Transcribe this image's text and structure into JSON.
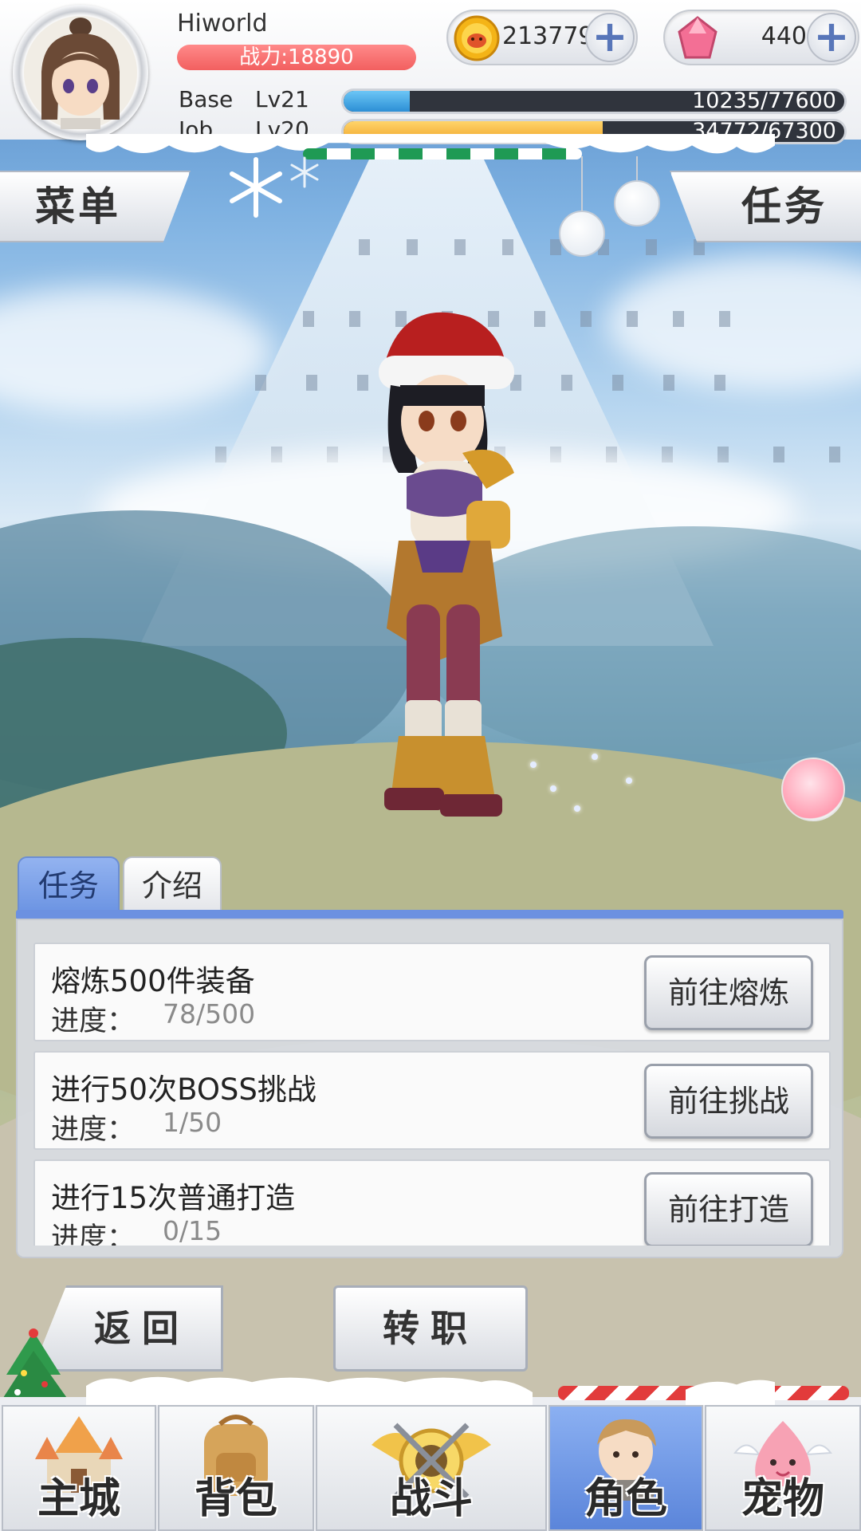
{
  "player": {
    "name": "Hiworld",
    "power": "战力:18890",
    "base_label": "Base",
    "base_level": "Lv21",
    "base_exp": "10235/77600",
    "base_progress": 0.132,
    "job_label": "Job",
    "job_level": "Lv20",
    "job_exp": "34772/67300",
    "job_progress": 0.517
  },
  "currency": {
    "gold": "213779",
    "gems": "440",
    "gold_icon": "coin-icon",
    "gem_icon": "crystal-icon",
    "add_icon": "plus-icon"
  },
  "buttons": {
    "menu": "菜单",
    "quest": "任务",
    "back": "返回",
    "job_change": "转职"
  },
  "panel": {
    "tabs": [
      {
        "label": "任务",
        "active": true
      },
      {
        "label": "介绍",
        "active": false
      }
    ],
    "progress_label": "进度：",
    "tasks": [
      {
        "title": "熔炼500件装备",
        "progress": "78/500",
        "action": "前往熔炼"
      },
      {
        "title": "进行50次BOSS挑战",
        "progress": "1/50",
        "action": "前往挑战"
      },
      {
        "title": "进行15次普通打造",
        "progress": "0/15",
        "action": "前往打造"
      }
    ]
  },
  "nav": [
    {
      "label": "主城",
      "icon": "castle-icon",
      "active": false
    },
    {
      "label": "背包",
      "icon": "backpack-icon",
      "active": false
    },
    {
      "label": "战斗",
      "icon": "battle-emblem-icon",
      "active": false
    },
    {
      "label": "角色",
      "icon": "character-icon",
      "active": true
    },
    {
      "label": "宠物",
      "icon": "pet-poring-icon",
      "active": false
    }
  ],
  "colors": {
    "accent_blue": "#6c91e1",
    "power_red": "#f25f5f",
    "base_bar": "#3aa6e6",
    "job_bar": "#f5b93a"
  }
}
